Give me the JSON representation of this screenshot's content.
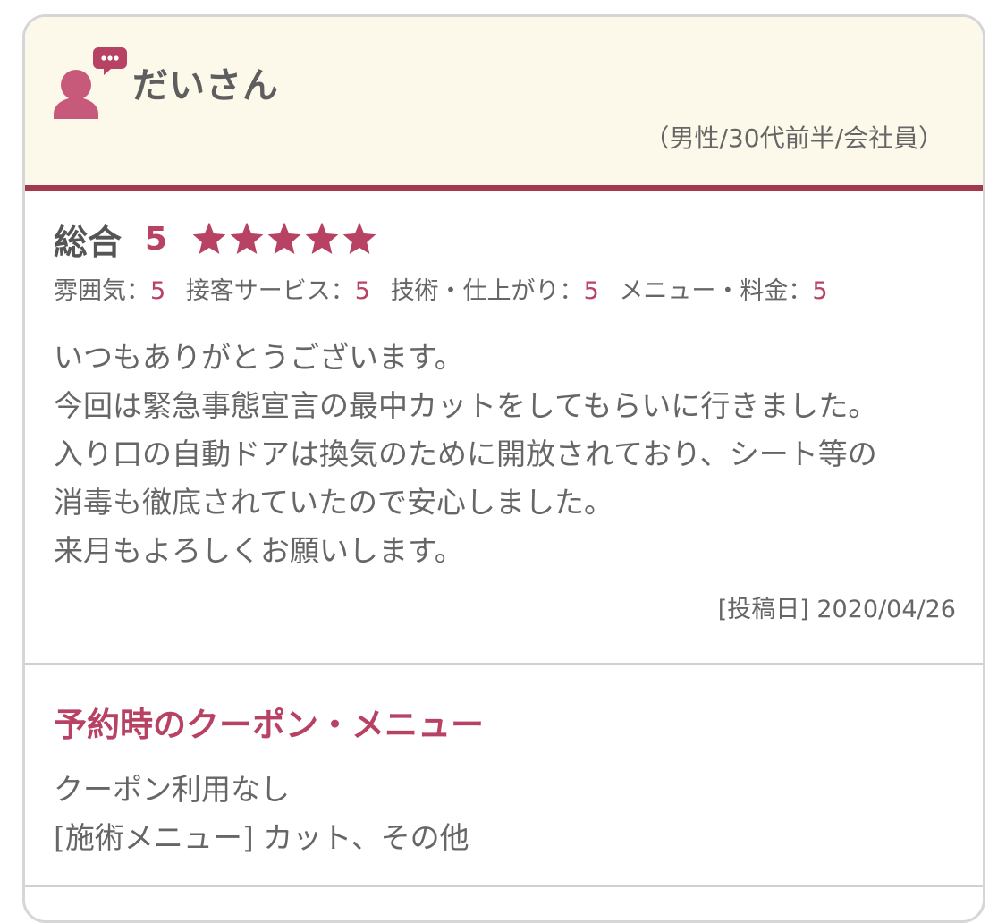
{
  "colors": {
    "accent": "#b84264",
    "header_bg": "#fcf8ea",
    "divider": "#a4384f",
    "text": "#666666"
  },
  "reviewer": {
    "icon": "user-comment-icon",
    "name": "だいさん",
    "profile": "（男性/30代前半/会社員）"
  },
  "rating": {
    "overall_label": "総合",
    "overall_score": "5",
    "stars_value": 5,
    "stars_max": 5,
    "sub": [
      {
        "label": "雰囲気：",
        "value": "5"
      },
      {
        "label": "接客サービス：",
        "value": "5"
      },
      {
        "label": "技術・仕上がり：",
        "value": "5"
      },
      {
        "label": "メニュー・料金：",
        "value": "5"
      }
    ]
  },
  "review": {
    "lines": [
      "いつもありがとうございます。",
      "今回は緊急事態宣言の最中カットをしてもらいに行きました。",
      "入り口の自動ドアは換気のために開放されており、シート等の",
      "消毒も徹底されていたので安心しました。",
      "来月もよろしくお願いします。"
    ],
    "posted": "[投稿日] 2020/04/26"
  },
  "coupon": {
    "title": "予約時のクーポン・メニュー",
    "coupon_text": "クーポン利用なし",
    "menu_text": "[施術メニュー] カット、その他"
  }
}
